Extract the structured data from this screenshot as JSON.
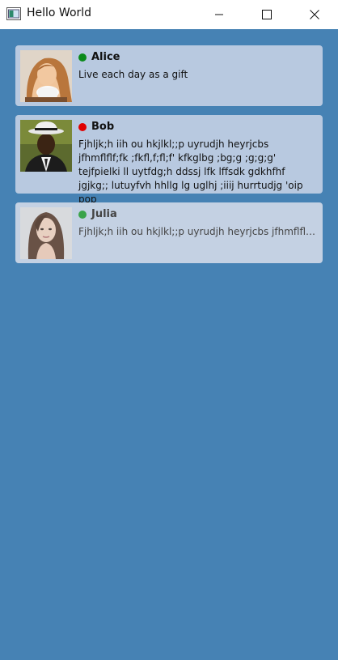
{
  "window": {
    "title": "Hello World",
    "controls": {
      "minimize_icon": "minimize-icon",
      "maximize_icon": "maximize-icon",
      "close_icon": "close-icon"
    }
  },
  "contacts": [
    {
      "name": "Alice",
      "status_color": "#0a8a1a",
      "message": "Live each day as a gift",
      "dimmed": false
    },
    {
      "name": "Bob",
      "status_color": "#e00000",
      "message": "Fjhljk;h iih  ou hkjlkl;;p uyrudjh heyrjcbs jfhmflflf;fk ;fkfl,f;fl;f' kfkglbg ;bg;g ;g;g;g' tejfpielki ll uytfdg;h ddssj lfk lffsdk gdkhfhf jgjkg;; lutuyfvh hhllg lg uglhj ;iiij hurrtudjg 'oip pop",
      "dimmed": false
    },
    {
      "name": "Julia",
      "status_color": "#3aa34a",
      "message": "Fjhljk;h iih  ou hkjlkl;;p uyrudjh heyrjcbs jfhmflflf;fk ;fkfl,f;fl;f' kfkglbg ;bg;g ;g;g;g' tejfpielki ll uytfdg;h ddssj lfk lffsdk gdkhfhf jgjkg;; lutuyfvh hhllg lg uglhj ;iiij hurrtudjg 'oip pop",
      "dimmed": true
    }
  ],
  "colors": {
    "background": "#4682b4",
    "card": "#b8c9e0"
  }
}
